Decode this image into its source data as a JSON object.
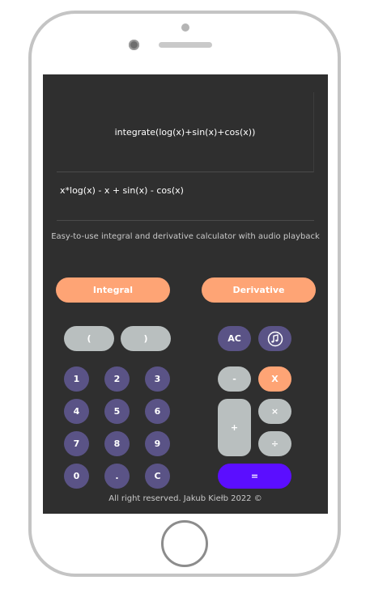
{
  "calculator": {
    "expression": "integrate(log(x)+sin(x)+cos(x))",
    "result": "x*log(x) - x + sin(x) - cos(x)",
    "tagline": "Easy-to-use integral and derivative calculator with audio playback",
    "modes": {
      "integral": "Integral",
      "derivative": "Derivative"
    },
    "keys": {
      "open_paren": "(",
      "close_paren": ")",
      "ac": "AC",
      "digits": [
        "1",
        "2",
        "3",
        "4",
        "5",
        "6",
        "7",
        "8",
        "9",
        "0"
      ],
      "dot": ".",
      "clear": "C",
      "minus": "-",
      "x_var": "X",
      "plus": "+",
      "multiply": "×",
      "divide": "÷",
      "equals": "="
    },
    "icons": {
      "audio": "music-note-icon"
    },
    "colors": {
      "accent": "#fea475",
      "key": "#5a5386",
      "equals": "#5b0eff",
      "screen": "#2f2f2f"
    },
    "footer": "All right reserved. Jakub Kiełb 2022 ©"
  }
}
